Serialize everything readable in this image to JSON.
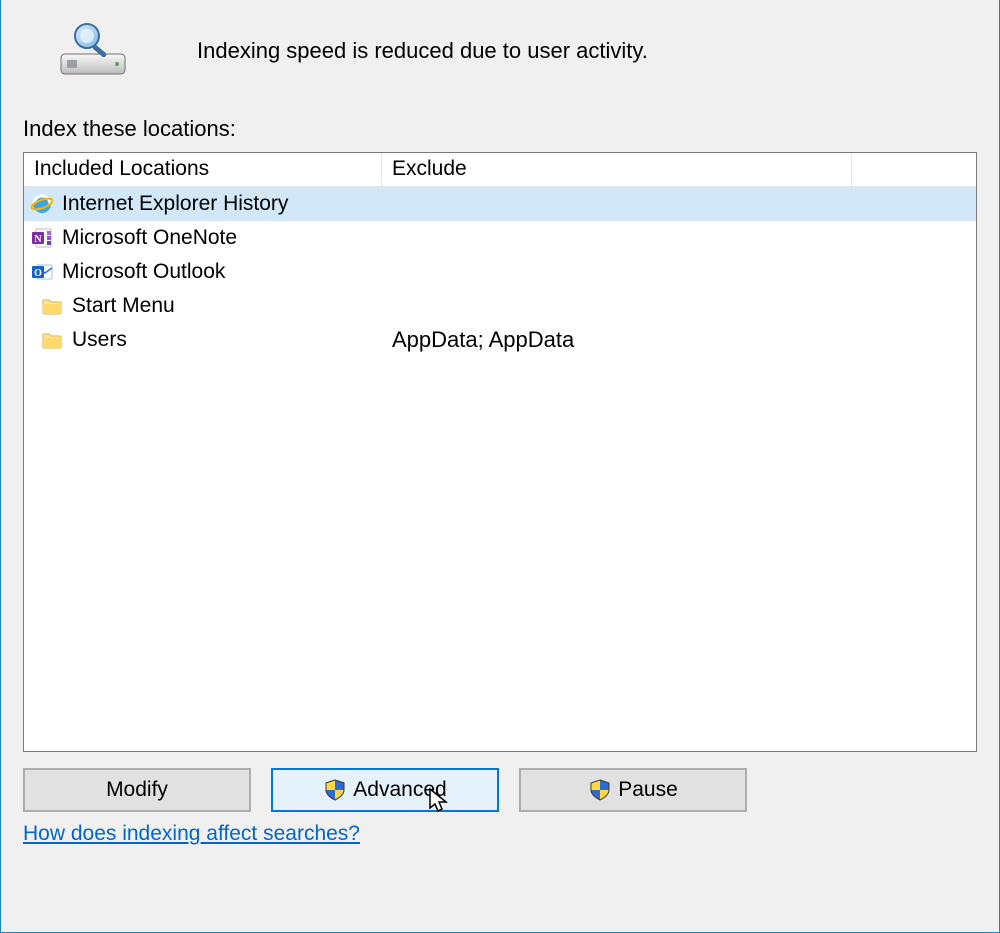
{
  "status_text": "Indexing speed is reduced due to user activity.",
  "section_label": "Index these locations:",
  "columns": {
    "included": "Included Locations",
    "exclude": "Exclude"
  },
  "rows": [
    {
      "icon": "ie",
      "label": "Internet Explorer History",
      "exclude": "",
      "selected": true,
      "indent": false
    },
    {
      "icon": "onenote",
      "label": "Microsoft OneNote",
      "exclude": "",
      "selected": false,
      "indent": false
    },
    {
      "icon": "outlook",
      "label": "Microsoft Outlook",
      "exclude": "",
      "selected": false,
      "indent": false
    },
    {
      "icon": "folder",
      "label": "Start Menu",
      "exclude": "",
      "selected": false,
      "indent": true
    },
    {
      "icon": "folder",
      "label": "Users",
      "exclude": "AppData; AppData",
      "selected": false,
      "indent": true
    }
  ],
  "buttons": {
    "modify_label": "Modify",
    "advanced_label": "Advanced",
    "pause_label": "Pause"
  },
  "help_link_label": "How does indexing affect searches?"
}
